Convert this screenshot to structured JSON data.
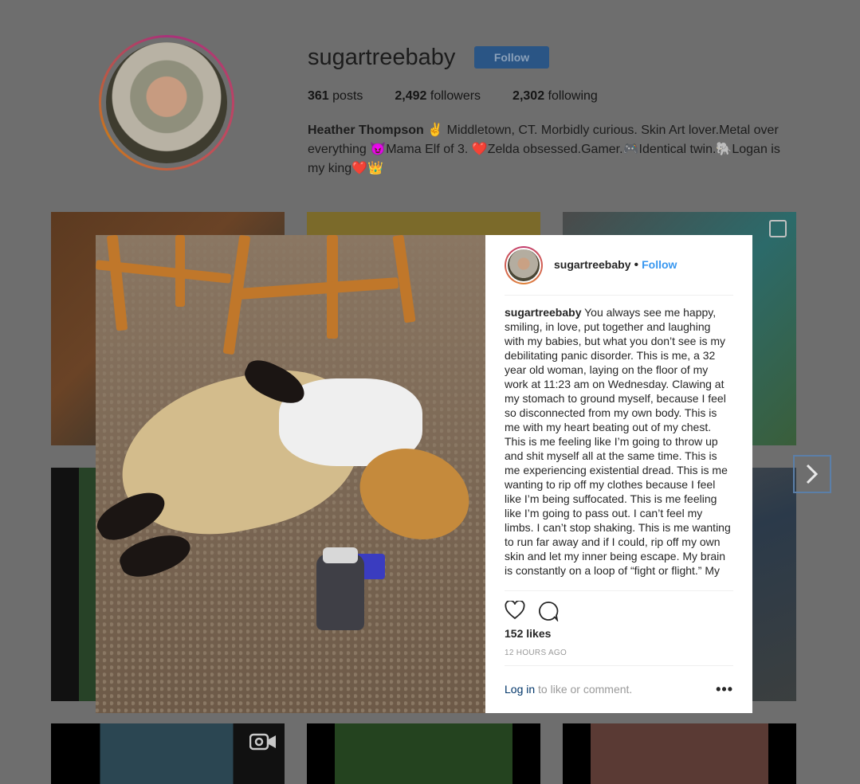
{
  "profile": {
    "username": "sugartreebaby",
    "follow_label": "Follow",
    "posts_count": "361",
    "posts_label": "posts",
    "followers_count": "2,492",
    "followers_label": "followers",
    "following_count": "2,302",
    "following_label": "following",
    "name": "Heather Thompson",
    "bio_line1": " ✌️ Middletown, CT. Morbidly curious. Skin Art lover.Metal over",
    "bio_line2": "everything 😈Mama Elf of 3. ❤️Zelda obsessed.Gamer.🎮Identical twin.🐘Logan is",
    "bio_line3": "my king❤️👑"
  },
  "grid": {
    "video_icon": "video-camera-icon",
    "multi_icon": "multiple-photos-icon"
  },
  "modal": {
    "username": "sugartreebaby",
    "separator": "•",
    "follow_label": "Follow",
    "caption_user": "sugartreebaby",
    "caption_text": " You always see me happy, smiling, in love, put together and laughing with my babies, but what you don’t see is my debilitating panic disorder. This is me, a 32 year old woman, laying on the floor of my work at 11:23 am on Wednesday. Clawing at my stomach to ground myself, because I feel so disconnected from my own body. This is me with my heart beating out of my chest. This is me feeling like I’m going to throw up and shit myself all at the same time. This is me experiencing existential dread. This is me wanting to rip off my clothes because I feel like I’m being suffocated. This is me feeling like I’m going to pass out. I can’t feel my limbs. I can’t stop shaking. This is me wanting to run far away and if I could, rip off my own skin and let my inner being escape. My brain is constantly on a loop of “fight or flight.” My",
    "likes": "152 likes",
    "time": "12 HOURS AGO",
    "login_link": "Log in",
    "login_suffix": " to like or comment.",
    "more_label": "•••"
  },
  "icons": {
    "like": "heart-icon",
    "comment": "comment-bubble-icon",
    "next": "chevron-right-icon"
  }
}
